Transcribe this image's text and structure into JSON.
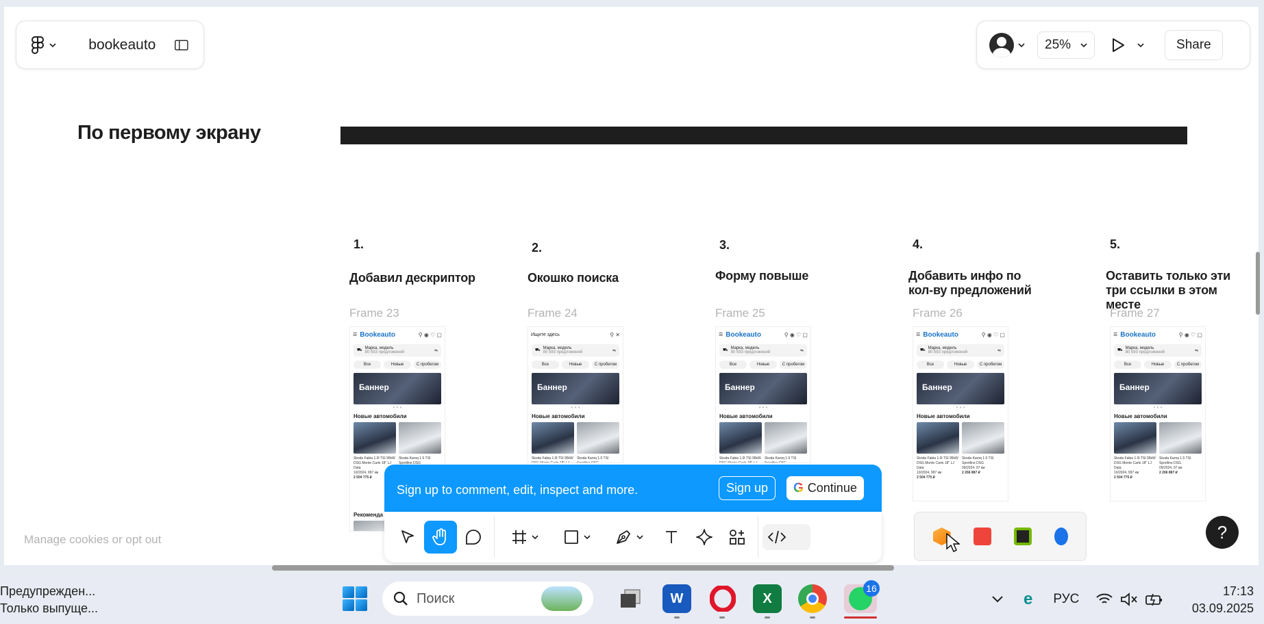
{
  "header": {
    "file_name": "bookeauto",
    "zoom": "25%",
    "share_label": "Share"
  },
  "page": {
    "section_title": "По первому экрану"
  },
  "columns": [
    {
      "num": "1.",
      "title_lines": [
        "Добавил дескриптор"
      ],
      "frame": "Frame 23",
      "variant": "main"
    },
    {
      "num": "2.",
      "title_lines": [
        "Окошко поиска"
      ],
      "frame": "Frame 24",
      "variant": "search"
    },
    {
      "num": "3.",
      "title_lines": [
        "Форму повыше"
      ],
      "frame": "Frame 25",
      "variant": "main"
    },
    {
      "num": "4.",
      "title_lines": [
        "Добавить инфо по",
        "кол-ву предложений"
      ],
      "frame": "Frame 26",
      "variant": "main"
    },
    {
      "num": "5.",
      "title_lines": [
        "Оставить только эти",
        "три ссылки в этом",
        "месте"
      ],
      "frame": "Frame 27",
      "variant": "main"
    }
  ],
  "mockup": {
    "logo": "Bookeauto",
    "search_prompt": "Ищите здесь",
    "search_title": "Марка, модель",
    "search_sub": "80 593 предложений",
    "tabs": [
      "Все",
      "Новые",
      "С пробегом"
    ],
    "banner": "Баннер",
    "section": "Новые автомобили",
    "car1_name": "Skoda Fabia 1.0l TSI 95kW DSG Monte Carlo 18\" LJ Data",
    "car1_meta": "10/2024, 997 км",
    "car1_price": "2 504 775 ₽",
    "car2_name": "Skoda Karoq 1.5 TSI Sportline DSG",
    "car2_meta": "09/2024, 97 км",
    "car2_price": "2 266 887 ₽",
    "recommend": "Рекоменда"
  },
  "signup": {
    "text": "Sign up to comment, edit, inspect and more.",
    "signup_label": "Sign up",
    "continue_label": "Continue"
  },
  "cookies": {
    "text": "Manage cookies or opt out"
  },
  "taskbar": {
    "notif_title": "Предупрежден...",
    "notif_sub": "Только выпуще...",
    "search_placeholder": "Поиск",
    "whatsapp_badge": "16",
    "lang": "РУС",
    "time": "17:13",
    "date": "03.09.2025"
  },
  "colors": {
    "accent": "#0d99ff",
    "dark_bar": "#1e1e1e",
    "logo_blue": "#1a73c8"
  }
}
